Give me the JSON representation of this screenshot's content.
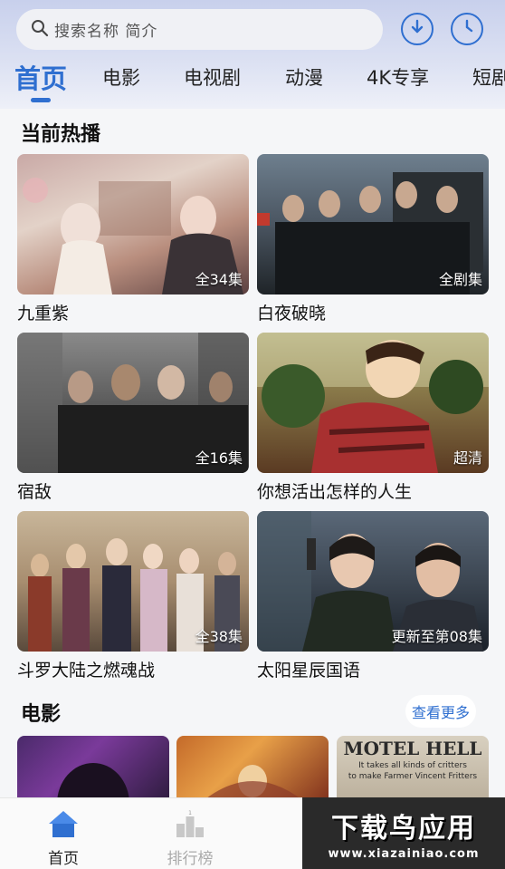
{
  "search": {
    "placeholder": "搜索名称 简介"
  },
  "header_icons": [
    "download-icon",
    "history-icon"
  ],
  "tabs": [
    {
      "label": "首页",
      "active": true
    },
    {
      "label": "电影"
    },
    {
      "label": "电视剧"
    },
    {
      "label": "动漫"
    },
    {
      "label": "4K专享"
    },
    {
      "label": "短剧"
    }
  ],
  "now_playing": {
    "title": "当前热播",
    "items": [
      {
        "title": "九重紫",
        "badge": "全34集"
      },
      {
        "title": "白夜破晓",
        "badge": "全剧集"
      },
      {
        "title": "宿敌",
        "badge": "全16集"
      },
      {
        "title": "你想活出怎样的人生",
        "badge": "超清"
      },
      {
        "title": "斗罗大陆之燃魂战",
        "badge": "全38集"
      },
      {
        "title": "太阳星辰国语",
        "badge": "更新至第08集"
      }
    ]
  },
  "movies": {
    "title": "电影",
    "more_label": "查看更多",
    "posters": [
      {
        "name": "movie-poster-1"
      },
      {
        "name": "movie-poster-2"
      },
      {
        "name": "movie-poster-3",
        "text_line1": "MOTEL HELL",
        "text_line2": "It takes all kinds of critters",
        "text_line3": "to make Farmer Vincent Fritters"
      }
    ]
  },
  "bottom_nav": [
    {
      "label": "首页",
      "icon": "home-icon",
      "active": true
    },
    {
      "label": "排行榜",
      "icon": "ranking-icon"
    }
  ],
  "watermark": {
    "big": "下载鸟应用",
    "small": "www.xiazainiao.com"
  },
  "colors": {
    "accent": "#2f6fd0",
    "background": "#f5f6f8"
  }
}
